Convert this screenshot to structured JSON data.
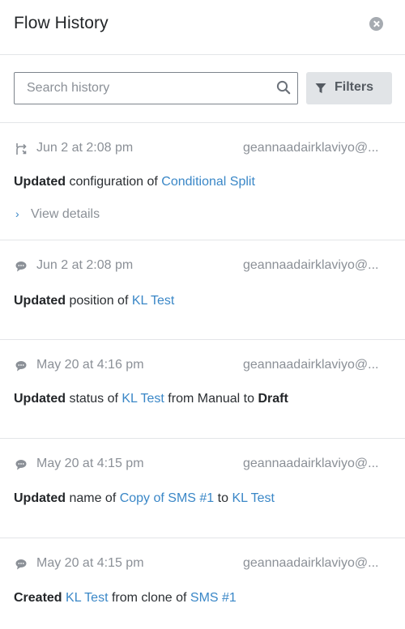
{
  "header": {
    "title": "Flow History"
  },
  "search": {
    "placeholder": "Search history"
  },
  "filters": {
    "label": "Filters"
  },
  "colors": {
    "link": "#3a87c7",
    "muted": "#8b9097",
    "text": "#2b2f33",
    "filter_bg": "#e1e4e7"
  },
  "entries": [
    {
      "icon": "split-icon",
      "timestamp": "Jun 2 at 2:08 pm",
      "user": "geannaadairklaviyo@...",
      "action": "Updated",
      "text1": " configuration of ",
      "link1": "Conditional Split",
      "view_details": "View details"
    },
    {
      "icon": "message-icon",
      "timestamp": "Jun 2 at 2:08 pm",
      "user": "geannaadairklaviyo@...",
      "action": "Updated",
      "text1": " position of ",
      "link1": "KL Test"
    },
    {
      "icon": "message-icon",
      "timestamp": "May 20 at 4:16 pm",
      "user": "geannaadairklaviyo@...",
      "action": "Updated",
      "text1": " status of ",
      "link1": "KL Test",
      "text2": " from Manual to ",
      "bold2": "Draft"
    },
    {
      "icon": "message-icon",
      "timestamp": "May 20 at 4:15 pm",
      "user": "geannaadairklaviyo@...",
      "action": "Updated",
      "text1": " name of ",
      "link1": "Copy of SMS #1",
      "text2": " to ",
      "link2": "KL Test"
    },
    {
      "icon": "message-icon",
      "timestamp": "May 20 at 4:15 pm",
      "user": "geannaadairklaviyo@...",
      "action": "Created",
      "text1": " ",
      "link1": "KL Test",
      "text2": " from clone of ",
      "link2": "SMS #1"
    }
  ]
}
